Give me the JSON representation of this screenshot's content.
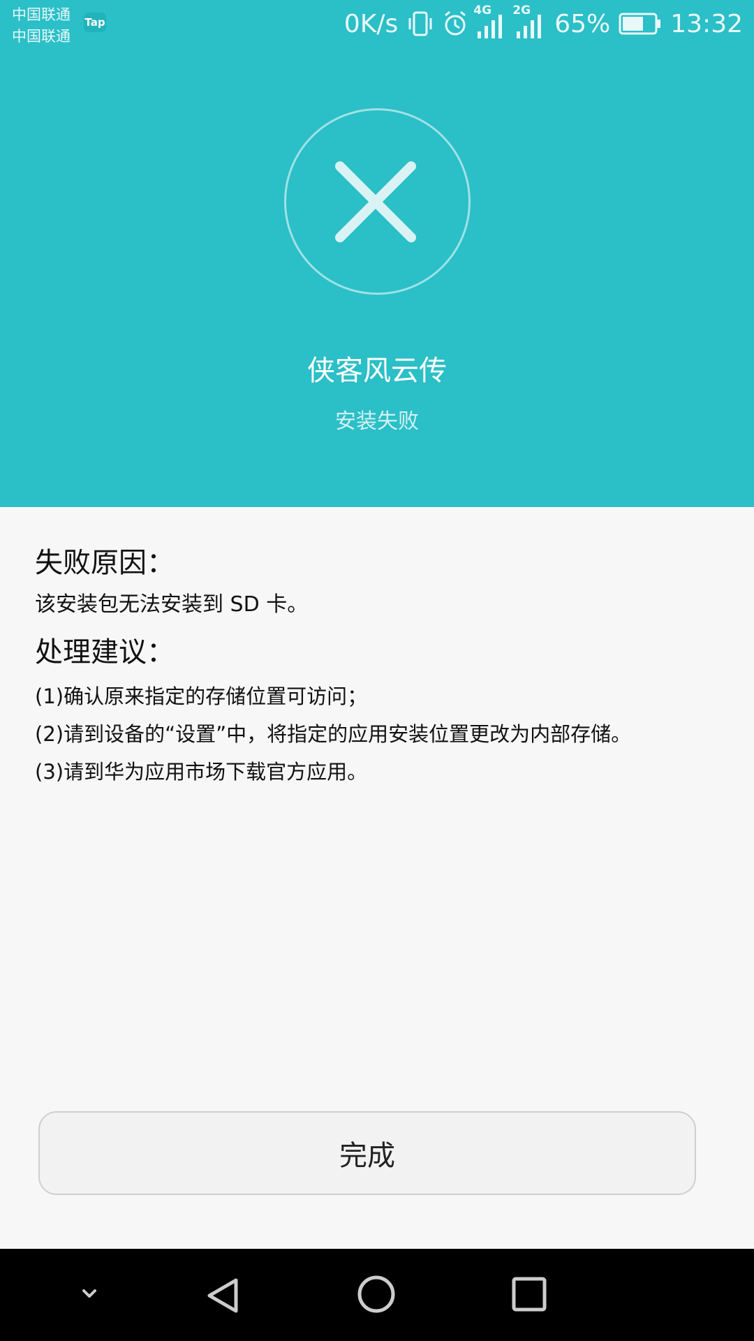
{
  "status_bar": {
    "carrier_1": "中国联通",
    "carrier_2": "中国联通",
    "tap_badge": "Tap",
    "net_speed": "0K/s",
    "net_1": "4G",
    "net_2": "2G",
    "battery_percent": "65%",
    "battery_level": 0.65,
    "time": "13:32",
    "icons": [
      "vibrate-icon",
      "alarm-icon",
      "signal-icon",
      "battery-icon"
    ]
  },
  "result": {
    "icon": "close-icon",
    "app_name": "侠客风云传",
    "status": "安装失败"
  },
  "details": {
    "reason_heading": "失败原因：",
    "reason_text": "该安装包无法安装到 SD 卡。",
    "suggestion_heading": "处理建议：",
    "suggestions": [
      "(1)确认原来指定的存储位置可访问；",
      "(2)请到设备的“设置”中，将指定的应用安装位置更改为内部存储。",
      "(3)请到华为应用市场下载官方应用。"
    ]
  },
  "actions": {
    "done_label": "完成"
  },
  "nav_bar": {
    "icons": [
      "chevron-down-icon",
      "back-icon",
      "home-icon",
      "recents-icon"
    ]
  },
  "colors": {
    "header_bg": "#2bbfc7",
    "page_bg": "#f7f7f7",
    "nav_bg": "#000000"
  }
}
